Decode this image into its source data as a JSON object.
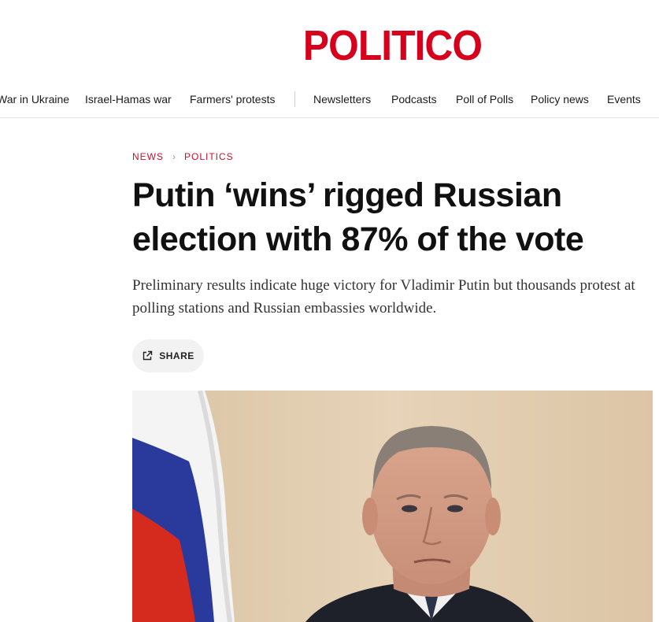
{
  "brand": {
    "logo_text": "POLITICO",
    "color": "#d6001c"
  },
  "nav": {
    "items": [
      {
        "label": "War in Ukraine"
      },
      {
        "label": "Israel-Hamas war"
      },
      {
        "label": "Farmers' protests"
      },
      {
        "label": "Newsletters"
      },
      {
        "label": "Podcasts"
      },
      {
        "label": "Poll of Polls"
      },
      {
        "label": "Policy news"
      },
      {
        "label": "Events"
      }
    ]
  },
  "breadcrumb": {
    "section": "NEWS",
    "subsection": "POLITICS",
    "color": "#c8102e"
  },
  "article": {
    "headline": "Putin ‘wins’ rigged Russian election with 87% of the vote",
    "dek": "Preliminary results indicate huge victory for Vladimir Putin but thousands protest at polling stations and Russian embassies worldwide.",
    "share_label": "SHARE",
    "share_icon": "share-icon",
    "hero_image": "photo-of-vladimir-putin-beside-russian-flag"
  }
}
